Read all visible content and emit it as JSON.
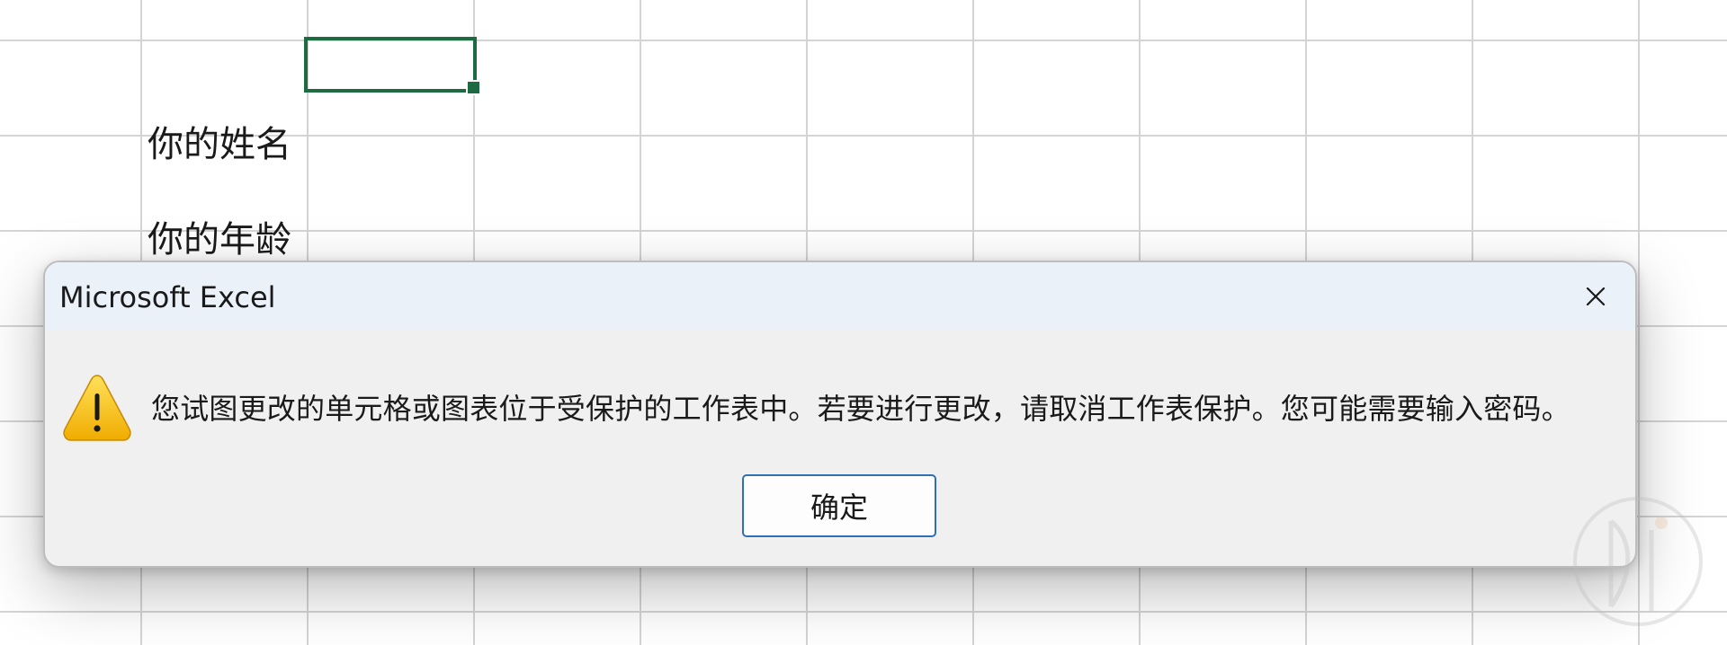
{
  "sheet": {
    "cells": {
      "label_name": "你的姓名",
      "label_age": "你的年龄"
    }
  },
  "dialog": {
    "title": "Microsoft Excel",
    "message": "您试图更改的单元格或图表位于受保护的工作表中。若要进行更改，请取消工作表保护。您可能需要输入密码。",
    "ok_label": "确定",
    "icon": "warning-icon",
    "close_icon": "close-icon"
  },
  "colors": {
    "selection_border": "#1e6b41",
    "dialog_title_bg": "#eaf1f8",
    "dialog_body_bg": "#f0f0f0",
    "button_border": "#2f6fb4",
    "warning_fill": "#f5c518"
  }
}
